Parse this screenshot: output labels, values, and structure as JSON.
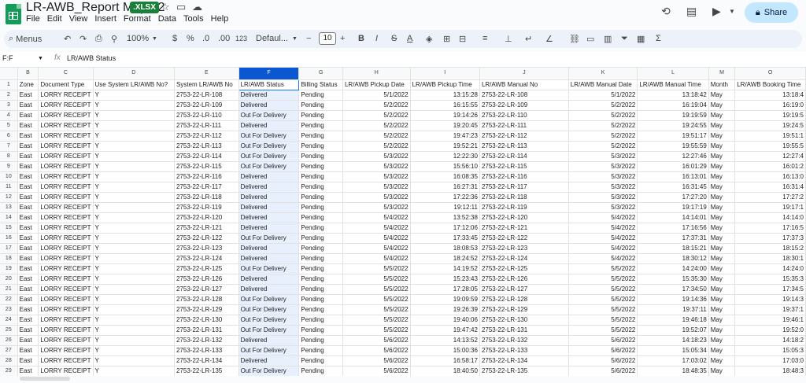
{
  "title": "LR-AWB_Report May-22",
  "badge": ".XLSX",
  "menu": [
    "File",
    "Edit",
    "View",
    "Insert",
    "Format",
    "Data",
    "Tools",
    "Help"
  ],
  "share_label": "Share",
  "toolbar": {
    "menus_label": "Menus",
    "zoom": "100%",
    "currency": "$",
    "percent": "%",
    "dec_decrease": ".0",
    "dec_increase": ".00",
    "number_format": "123",
    "font": "Defaul...",
    "font_size": "10"
  },
  "formula_bar": {
    "name_box": "F:F",
    "fx": "fx",
    "content": "LR/AWB Status"
  },
  "columns": [
    {
      "letter": "B",
      "header": "Zone"
    },
    {
      "letter": "C",
      "header": "Document Type"
    },
    {
      "letter": "D",
      "header": "Use System LR/AWB No?"
    },
    {
      "letter": "E",
      "header": "System LR/AWB No"
    },
    {
      "letter": "F",
      "header": "LR/AWB Status"
    },
    {
      "letter": "G",
      "header": "Billing Status"
    },
    {
      "letter": "H",
      "header": "LR/AWB Pickup Date"
    },
    {
      "letter": "I",
      "header": "LR/AWB Pickup Time"
    },
    {
      "letter": "J",
      "header": "LR/AWB Manual No"
    },
    {
      "letter": "K",
      "header": "LR/AWB Manual Date"
    },
    {
      "letter": "L",
      "header": "LR/AWB Manual Time"
    },
    {
      "letter": "M",
      "header": "Month"
    },
    {
      "letter": "O",
      "header": "LR/AWB Booking Time"
    }
  ],
  "rows": [
    [
      "2",
      "East",
      "LORRY RECEIPT",
      "Y",
      "2753-22-LR-108",
      "Delivered",
      "Pending",
      "5/1/2022",
      "13:15:28",
      "2753-22-LR-108",
      "5/1/2022",
      "13:18:42",
      "May",
      "13:18:4"
    ],
    [
      "3",
      "East",
      "LORRY RECEIPT",
      "Y",
      "2753-22-LR-109",
      "Delivered",
      "Pending",
      "5/2/2022",
      "16:15:55",
      "2753-22-LR-109",
      "5/2/2022",
      "16:19:04",
      "May",
      "16:19:0"
    ],
    [
      "4",
      "East",
      "LORRY RECEIPT",
      "Y",
      "2753-22-LR-110",
      "Out For Delivery",
      "Pending",
      "5/2/2022",
      "19:14:26",
      "2753-22-LR-110",
      "5/2/2022",
      "19:19:59",
      "May",
      "19:19:5"
    ],
    [
      "5",
      "East",
      "LORRY RECEIPT",
      "Y",
      "2753-22-LR-111",
      "Delivered",
      "Pending",
      "5/2/2022",
      "19:20:45",
      "2753-22-LR-111",
      "5/2/2022",
      "19:24:55",
      "May",
      "19:24:5"
    ],
    [
      "6",
      "East",
      "LORRY RECEIPT",
      "Y",
      "2753-22-LR-112",
      "Out For Delivery",
      "Pending",
      "5/2/2022",
      "19:47:23",
      "2753-22-LR-112",
      "5/2/2022",
      "19:51:17",
      "May",
      "19:51:1"
    ],
    [
      "7",
      "East",
      "LORRY RECEIPT",
      "Y",
      "2753-22-LR-113",
      "Out For Delivery",
      "Pending",
      "5/2/2022",
      "19:52:21",
      "2753-22-LR-113",
      "5/2/2022",
      "19:55:59",
      "May",
      "19:55:5"
    ],
    [
      "8",
      "East",
      "LORRY RECEIPT",
      "Y",
      "2753-22-LR-114",
      "Out For Delivery",
      "Pending",
      "5/3/2022",
      "12:22:30",
      "2753-22-LR-114",
      "5/3/2022",
      "12:27:46",
      "May",
      "12:27:4"
    ],
    [
      "9",
      "East",
      "LORRY RECEIPT",
      "Y",
      "2753-22-LR-115",
      "Out For Delivery",
      "Pending",
      "5/3/2022",
      "15:56:10",
      "2753-22-LR-115",
      "5/3/2022",
      "16:01:29",
      "May",
      "16:01:2"
    ],
    [
      "10",
      "East",
      "LORRY RECEIPT",
      "Y",
      "2753-22-LR-116",
      "Delivered",
      "Pending",
      "5/3/2022",
      "16:08:35",
      "2753-22-LR-116",
      "5/3/2022",
      "16:13:01",
      "May",
      "16:13:0"
    ],
    [
      "11",
      "East",
      "LORRY RECEIPT",
      "Y",
      "2753-22-LR-117",
      "Delivered",
      "Pending",
      "5/3/2022",
      "16:27:31",
      "2753-22-LR-117",
      "5/3/2022",
      "16:31:45",
      "May",
      "16:31:4"
    ],
    [
      "12",
      "East",
      "LORRY RECEIPT",
      "Y",
      "2753-22-LR-118",
      "Delivered",
      "Pending",
      "5/3/2022",
      "17:22:36",
      "2753-22-LR-118",
      "5/3/2022",
      "17:27:20",
      "May",
      "17:27:2"
    ],
    [
      "13",
      "East",
      "LORRY RECEIPT",
      "Y",
      "2753-22-LR-119",
      "Delivered",
      "Pending",
      "5/3/2022",
      "19:12:11",
      "2753-22-LR-119",
      "5/3/2022",
      "19:17:19",
      "May",
      "19:17:1"
    ],
    [
      "14",
      "East",
      "LORRY RECEIPT",
      "Y",
      "2753-22-LR-120",
      "Delivered",
      "Pending",
      "5/4/2022",
      "13:52:38",
      "2753-22-LR-120",
      "5/4/2022",
      "14:14:01",
      "May",
      "14:14:0"
    ],
    [
      "15",
      "East",
      "LORRY RECEIPT",
      "Y",
      "2753-22-LR-121",
      "Delivered",
      "Pending",
      "5/4/2022",
      "17:12:06",
      "2753-22-LR-121",
      "5/4/2022",
      "17:16:56",
      "May",
      "17:16:5"
    ],
    [
      "16",
      "East",
      "LORRY RECEIPT",
      "Y",
      "2753-22-LR-122",
      "Out For Delivery",
      "Pending",
      "5/4/2022",
      "17:33:45",
      "2753-22-LR-122",
      "5/4/2022",
      "17:37:31",
      "May",
      "17:37:3"
    ],
    [
      "17",
      "East",
      "LORRY RECEIPT",
      "Y",
      "2753-22-LR-123",
      "Delivered",
      "Pending",
      "5/4/2022",
      "18:08:53",
      "2753-22-LR-123",
      "5/4/2022",
      "18:15:21",
      "May",
      "18:15:2"
    ],
    [
      "18",
      "East",
      "LORRY RECEIPT",
      "Y",
      "2753-22-LR-124",
      "Delivered",
      "Pending",
      "5/4/2022",
      "18:24:52",
      "2753-22-LR-124",
      "5/4/2022",
      "18:30:12",
      "May",
      "18:30:1"
    ],
    [
      "19",
      "East",
      "LORRY RECEIPT",
      "Y",
      "2753-22-LR-125",
      "Out For Delivery",
      "Pending",
      "5/5/2022",
      "14:19:52",
      "2753-22-LR-125",
      "5/5/2022",
      "14:24:00",
      "May",
      "14:24:0"
    ],
    [
      "20",
      "East",
      "LORRY RECEIPT",
      "Y",
      "2753-22-LR-126",
      "Delivered",
      "Pending",
      "5/5/2022",
      "15:23:43",
      "2753-22-LR-126",
      "5/5/2022",
      "15:35:30",
      "May",
      "15:35:3"
    ],
    [
      "21",
      "East",
      "LORRY RECEIPT",
      "Y",
      "2753-22-LR-127",
      "Delivered",
      "Pending",
      "5/5/2022",
      "17:28:05",
      "2753-22-LR-127",
      "5/5/2022",
      "17:34:50",
      "May",
      "17:34:5"
    ],
    [
      "22",
      "East",
      "LORRY RECEIPT",
      "Y",
      "2753-22-LR-128",
      "Out For Delivery",
      "Pending",
      "5/5/2022",
      "19:09:59",
      "2753-22-LR-128",
      "5/5/2022",
      "19:14:36",
      "May",
      "19:14:3"
    ],
    [
      "23",
      "East",
      "LORRY RECEIPT",
      "Y",
      "2753-22-LR-129",
      "Out For Delivery",
      "Pending",
      "5/5/2022",
      "19:26:39",
      "2753-22-LR-129",
      "5/5/2022",
      "19:37:11",
      "May",
      "19:37:1"
    ],
    [
      "24",
      "East",
      "LORRY RECEIPT",
      "Y",
      "2753-22-LR-130",
      "Out For Delivery",
      "Pending",
      "5/5/2022",
      "19:40:06",
      "2753-22-LR-130",
      "5/5/2022",
      "19:46:18",
      "May",
      "19:46:1"
    ],
    [
      "25",
      "East",
      "LORRY RECEIPT",
      "Y",
      "2753-22-LR-131",
      "Out For Delivery",
      "Pending",
      "5/5/2022",
      "19:47:42",
      "2753-22-LR-131",
      "5/5/2022",
      "19:52:07",
      "May",
      "19:52:0"
    ],
    [
      "26",
      "East",
      "LORRY RECEIPT",
      "Y",
      "2753-22-LR-132",
      "Delivered",
      "Pending",
      "5/6/2022",
      "14:13:52",
      "2753-22-LR-132",
      "5/6/2022",
      "14:18:23",
      "May",
      "14:18:2"
    ],
    [
      "27",
      "East",
      "LORRY RECEIPT",
      "Y",
      "2753-22-LR-133",
      "Out For Delivery",
      "Pending",
      "5/6/2022",
      "15:00:36",
      "2753-22-LR-133",
      "5/6/2022",
      "15:05:34",
      "May",
      "15:05:3"
    ],
    [
      "28",
      "East",
      "LORRY RECEIPT",
      "Y",
      "2753-22-LR-134",
      "Delivered",
      "Pending",
      "5/6/2022",
      "16:58:17",
      "2753-22-LR-134",
      "5/6/2022",
      "17:03:02",
      "May",
      "17:03:0"
    ],
    [
      "29",
      "East",
      "LORRY RECEIPT",
      "Y",
      "2753-22-LR-135",
      "Out For Delivery",
      "Pending",
      "5/6/2022",
      "18:40:50",
      "2753-22-LR-135",
      "5/6/2022",
      "18:48:35",
      "May",
      "18:48:3"
    ]
  ],
  "accent_color": "#0b57d0",
  "selected_column": "F"
}
